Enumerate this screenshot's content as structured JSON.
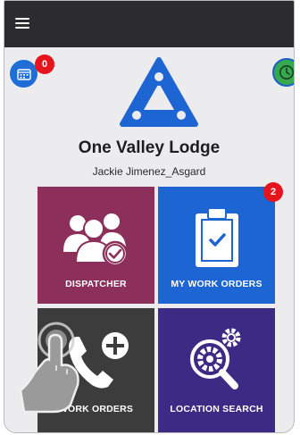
{
  "header": {
    "menu_icon": "hamburger-icon",
    "bar_color": "#2c2c2e"
  },
  "calendar": {
    "icon": "calendar-icon",
    "badge_count": "0",
    "color": "#1f6dd6"
  },
  "clock": {
    "icon": "clock-icon",
    "color": "#36a84e"
  },
  "org": {
    "name": "One Valley Lodge",
    "logo_icon": "triangle-network-logo",
    "logo_color": "#1d65d3"
  },
  "user": {
    "name": "Jackie Jimenez_Asgard"
  },
  "tiles": [
    {
      "label": "DISPATCHER",
      "icon": "group-check-icon",
      "color": "#8c2f5b"
    },
    {
      "label": "MY WORK ORDERS",
      "icon": "clipboard-check-icon",
      "color": "#1d65d3",
      "badge_count": "2"
    },
    {
      "label": "WORK ORDERS",
      "icon": "phone-add-icon",
      "color": "#3c3c3c"
    },
    {
      "label": "LOCATION SEARCH",
      "icon": "gear-search-icon",
      "color": "#3b2b84"
    }
  ],
  "overlay": {
    "icon": "tap-hand-icon"
  }
}
